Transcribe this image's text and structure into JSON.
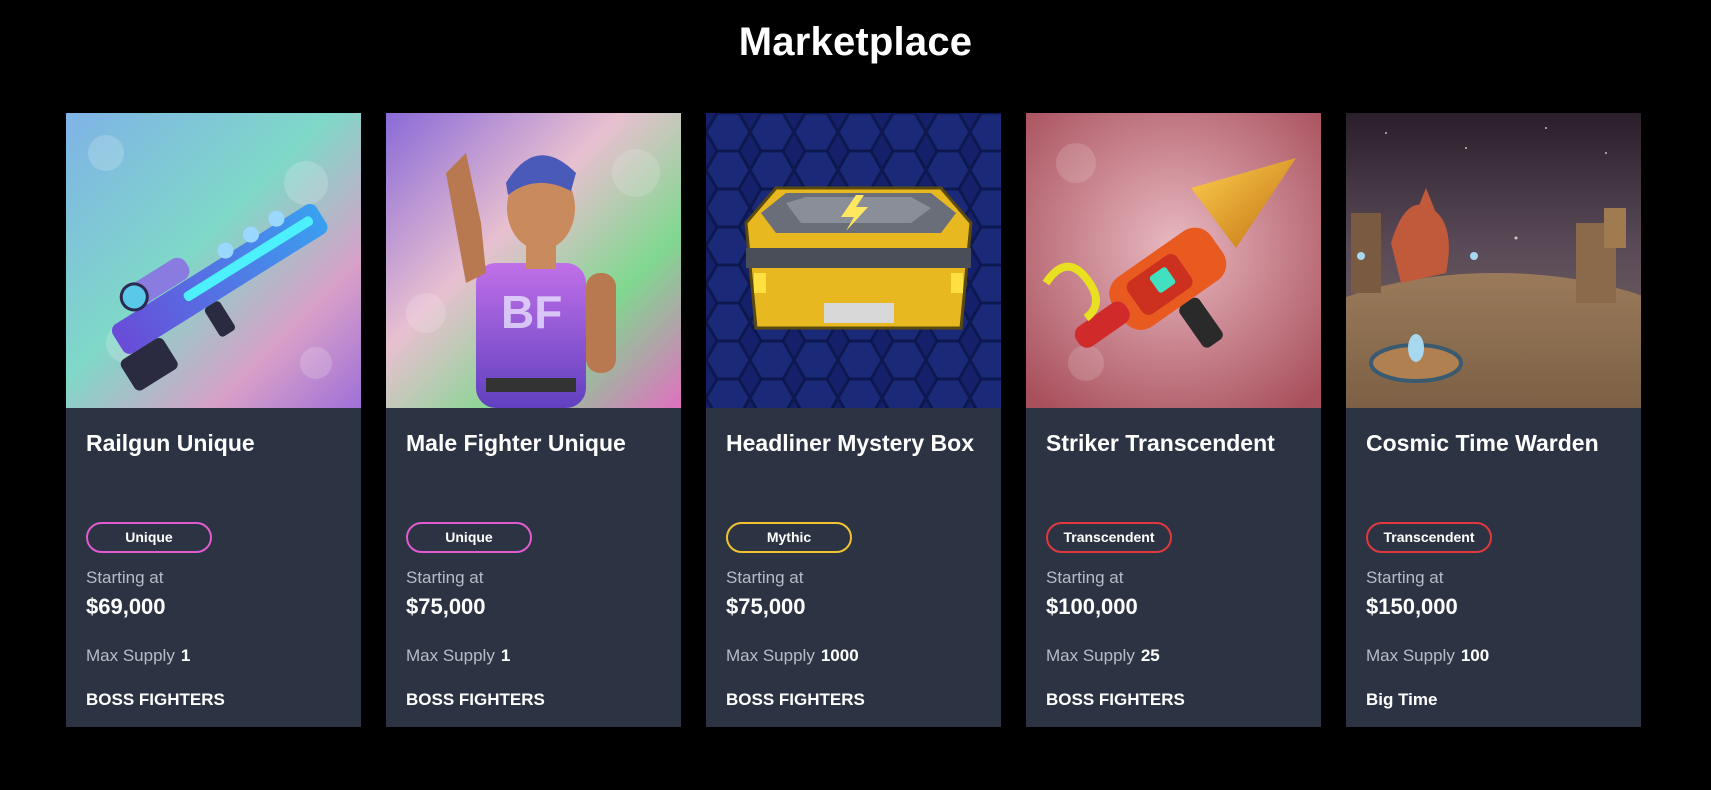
{
  "page": {
    "title": "Marketplace"
  },
  "labels": {
    "starting_at": "Starting at",
    "max_supply": "Max Supply"
  },
  "rarity_colors": {
    "Unique": "#e05ad0",
    "Mythic": "#f2c230",
    "Transcendent": "#e0383e"
  },
  "cards": [
    {
      "name": "Railgun Unique",
      "rarity": "Unique",
      "price": "$69,000",
      "max_supply": "1",
      "brand": "BOSS FIGHTERS",
      "image": "railgun-weapon"
    },
    {
      "name": "Male Fighter Unique",
      "rarity": "Unique",
      "price": "$75,000",
      "max_supply": "1",
      "brand": "BOSS FIGHTERS",
      "image": "male-fighter-character"
    },
    {
      "name": "Headliner Mystery Box",
      "rarity": "Mythic",
      "price": "$75,000",
      "max_supply": "1000",
      "brand": "BOSS FIGHTERS",
      "image": "mystery-box-crate"
    },
    {
      "name": "Striker Transcendent",
      "rarity": "Transcendent",
      "price": "$100,000",
      "max_supply": "25",
      "brand": "BOSS FIGHTERS",
      "image": "drill-gun-weapon"
    },
    {
      "name": "Cosmic Time Warden",
      "rarity": "Transcendent",
      "price": "$150,000",
      "max_supply": "100",
      "brand": "Big Time",
      "image": "cosmic-warden-scene"
    }
  ]
}
